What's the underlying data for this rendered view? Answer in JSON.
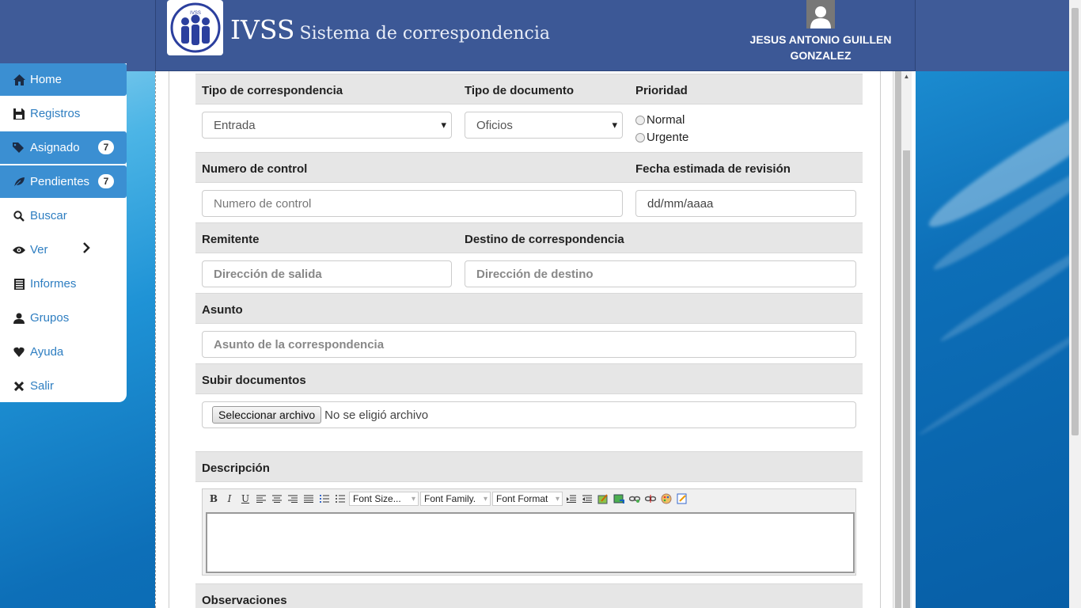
{
  "header": {
    "brand": "IVSS",
    "subtitle": "Sistema de correspondencia",
    "logo_text": "IVSS",
    "user_name_line1": "JESUS ANTONIO GUILLEN",
    "user_name_line2": "GONZALEZ"
  },
  "sidebar": {
    "items": [
      {
        "label": "Home",
        "icon": "home-icon"
      },
      {
        "label": "Registros",
        "icon": "save-icon"
      },
      {
        "label": "Asignado",
        "icon": "tags-icon",
        "badge": "7"
      },
      {
        "label": "Pendientes",
        "icon": "leaf-icon",
        "badge": "7"
      },
      {
        "label": "Buscar",
        "icon": "search-icon"
      },
      {
        "label": "Ver",
        "icon": "eye-icon"
      },
      {
        "label": "Informes",
        "icon": "list-icon"
      },
      {
        "label": "Grupos",
        "icon": "user-icon"
      },
      {
        "label": "Ayuda",
        "icon": "heart-icon"
      },
      {
        "label": "Salir",
        "icon": "close-icon"
      }
    ]
  },
  "form": {
    "tipo_correspondencia": {
      "label": "Tipo de correspondencia",
      "value": "Entrada"
    },
    "tipo_documento": {
      "label": "Tipo de documento",
      "value": "Oficios"
    },
    "prioridad": {
      "label": "Prioridad",
      "options": [
        "Normal",
        "Urgente"
      ]
    },
    "numero_control": {
      "label": "Numero de control",
      "placeholder": "Numero de control"
    },
    "fecha_revision": {
      "label": "Fecha estimada de revisión",
      "placeholder": "dd/mm/aaaa"
    },
    "remitente": {
      "label": "Remitente",
      "placeholder": "Dirección de salida"
    },
    "destino": {
      "label": "Destino de correspondencia",
      "placeholder": "Dirección de destino"
    },
    "asunto": {
      "label": "Asunto",
      "placeholder": "Asunto de la correspondencia"
    },
    "subir": {
      "label": "Subir documentos",
      "button": "Seleccionar archivo",
      "status": "No se eligió archivo"
    },
    "descripcion": {
      "label": "Descripción"
    },
    "observaciones": {
      "label": "Observaciones"
    }
  },
  "editor": {
    "font_size": "Font Size...",
    "font_family": "Font Family.",
    "font_format": "Font Format"
  }
}
